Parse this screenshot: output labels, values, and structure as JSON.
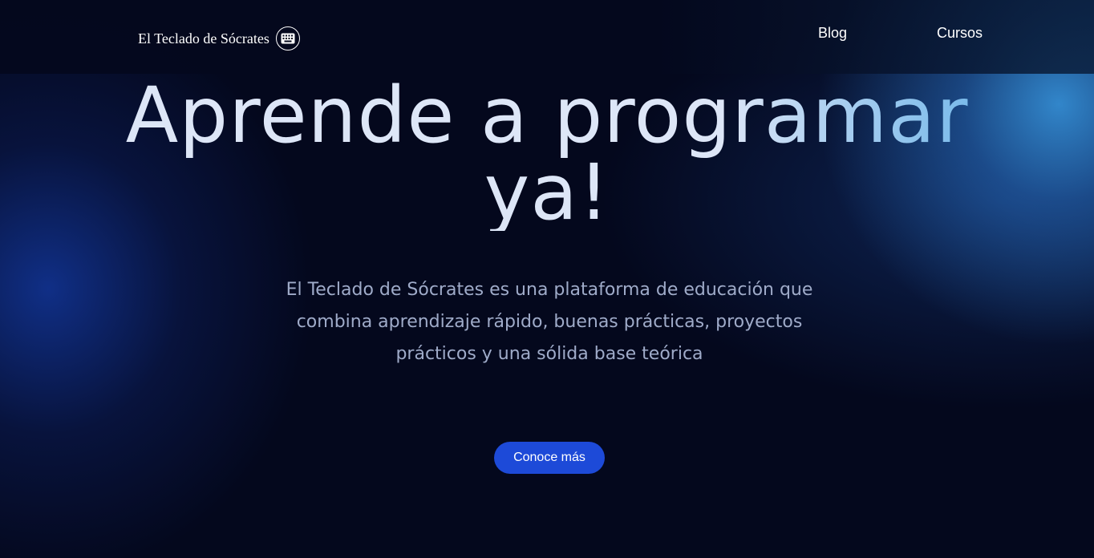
{
  "header": {
    "logo_text": "El Teclado de Sócrates",
    "logo_icon": "keyboard-icon",
    "nav": [
      {
        "label": "Blog"
      },
      {
        "label": "Cursos"
      }
    ]
  },
  "hero": {
    "title": "Aprende a programar ya!",
    "description": "El Teclado de Sócrates es una plataforma de educación que combina aprendizaje rápido, buenas prácticas, proyectos prácticos y una sólida base teórica",
    "cta_label": "Conoce más"
  },
  "colors": {
    "background": "#04081d",
    "accent_button": "#1d4ad8",
    "glow_blue": "#2f86c9",
    "text_primary": "#ffffff",
    "text_muted": "#9fabc9"
  }
}
